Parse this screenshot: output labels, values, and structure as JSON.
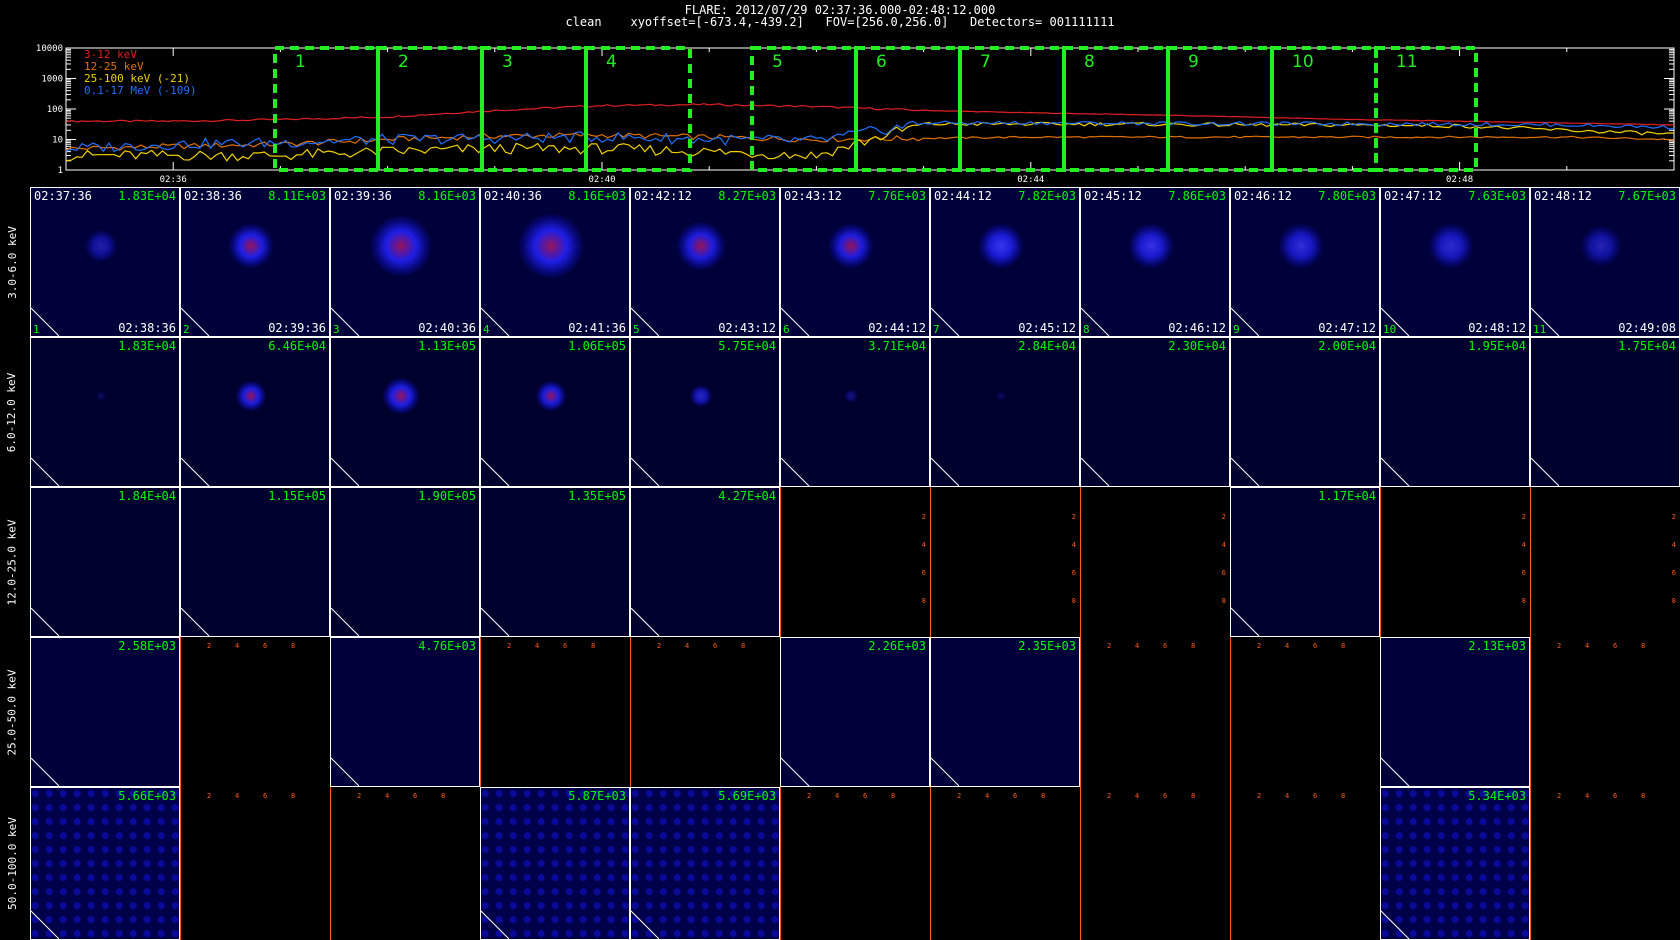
{
  "header": {
    "title": "FLARE: 2012/07/29 02:37:36.000-02:48:12.000",
    "subtitle": "clean    xyoffset=[-673.4,-439.2]   FOV=[256.0,256.0]   Detectors= 001111111"
  },
  "lightcurve": {
    "y_ticks": [
      "10000",
      "1000",
      "100",
      "10",
      "1"
    ],
    "x_ticks": [
      "02:36",
      "02:40",
      "02:44",
      "02:48"
    ],
    "interval_labels": [
      "1",
      "2",
      "3",
      "4",
      "5",
      "6",
      "7",
      "8",
      "9",
      "10",
      "11"
    ],
    "legend": [
      {
        "label": "3-12 keV",
        "color": "#e02020"
      },
      {
        "label": "12-25 keV",
        "color": "#e07000"
      },
      {
        "label": "25-100 keV (-21)",
        "color": "#f0d000"
      },
      {
        "label": "0.1-17 MeV (-109)",
        "color": "#2070ff"
      }
    ]
  },
  "chart_data": {
    "type": "line",
    "x_unit": "time (UT)",
    "y_scale": "log",
    "ylim": [
      1,
      10000
    ],
    "x": [
      "02:35",
      "02:36",
      "02:37",
      "02:38",
      "02:39",
      "02:40",
      "02:41",
      "02:42",
      "02:43",
      "02:44",
      "02:45",
      "02:46",
      "02:47",
      "02:48",
      "02:49",
      "02:50"
    ],
    "series": [
      {
        "name": "3-12 keV",
        "values": [
          40,
          40,
          45,
          55,
          90,
          130,
          140,
          120,
          90,
          75,
          65,
          55,
          45,
          40,
          35,
          30
        ]
      },
      {
        "name": "12-25 keV",
        "values": [
          5,
          6,
          7,
          10,
          13,
          14,
          12,
          10,
          11,
          12,
          12,
          12,
          12,
          12,
          12,
          10
        ]
      },
      {
        "name": "25-100 keV (-21)",
        "values": [
          3,
          3,
          3,
          4,
          5,
          5,
          4,
          3,
          32,
          32,
          32,
          30,
          30,
          28,
          20,
          15
        ]
      },
      {
        "name": "0.1-17 MeV (-109)",
        "values": [
          5,
          7,
          8,
          10,
          11,
          12,
          10,
          9,
          35,
          35,
          34,
          33,
          33,
          32,
          30,
          25
        ]
      }
    ]
  },
  "images": {
    "rows": [
      "3.0-6.0 keV",
      "6.0-12.0 keV",
      "12.0-25.0 keV",
      "25.0-50.0 keV",
      "50.0-100.0 keV"
    ],
    "start_times": [
      "02:37:36",
      "02:38:36",
      "02:39:36",
      "02:40:36",
      "02:42:12",
      "02:43:12",
      "02:44:12",
      "02:45:12",
      "02:46:12",
      "02:47:12",
      "02:48:12"
    ],
    "end_times": [
      "02:38:36",
      "02:39:36",
      "02:40:36",
      "02:41:36",
      "02:43:12",
      "02:44:12",
      "02:45:12",
      "02:46:12",
      "02:47:12",
      "02:48:12",
      "02:49:08"
    ],
    "peaks": [
      [
        "1.83E+04",
        "8.11E+03",
        "8.16E+03",
        "8.16E+03",
        "8.27E+03",
        "7.76E+03",
        "7.82E+03",
        "7.86E+03",
        "7.80E+03",
        "7.63E+03",
        "7.67E+03"
      ],
      [
        "1.83E+04",
        "6.46E+04",
        "1.13E+05",
        "1.06E+05",
        "5.75E+04",
        "3.71E+04",
        "2.84E+04",
        "2.30E+04",
        "2.00E+04",
        "1.95E+04",
        "1.75E+04"
      ],
      [
        "1.84E+04",
        "1.15E+05",
        "1.90E+05",
        "1.35E+05",
        "4.27E+04",
        "",
        "",
        "",
        "1.17E+04",
        "",
        ""
      ],
      [
        "2.58E+03",
        "",
        "4.76E+03",
        "",
        "",
        "2.26E+03",
        "2.35E+03",
        "",
        "",
        "2.13E+03",
        ""
      ],
      [
        "5.66E+03",
        "",
        "",
        "5.87E+03",
        "5.69E+03",
        "",
        "",
        "",
        "",
        "5.34E+03",
        ""
      ]
    ],
    "outline_ticks": [
      "2",
      "4",
      "6",
      "8"
    ]
  },
  "colors": {
    "accent_green": "#00ff00",
    "empty_panel_axis": "#ff5a14",
    "image_blue": "#1010c8"
  }
}
